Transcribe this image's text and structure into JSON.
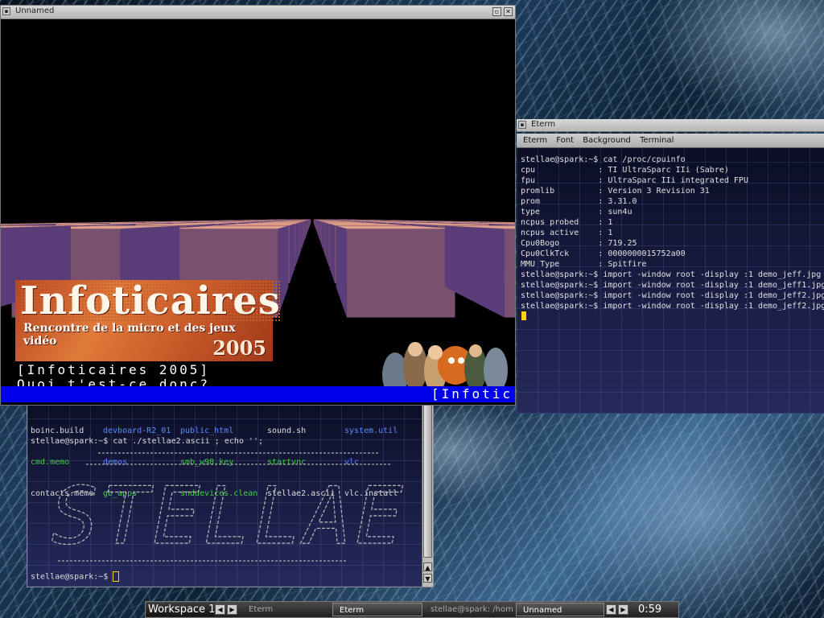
{
  "windows": {
    "demo": {
      "title": "Unnamed"
    },
    "eterm_top": {
      "title": "Eterm",
      "menu": [
        "Eterm",
        "Font",
        "Background",
        "Terminal"
      ],
      "lines": [
        "stellae@spark:~$ cat /proc/cpuinfo",
        "cpu             : TI UltraSparc IIi (Sabre)",
        "fpu             : UltraSparc IIi integrated FPU",
        "promlib         : Version 3 Revision 31",
        "prom            : 3.31.0",
        "type            : sun4u",
        "ncpus probed    : 1",
        "ncpus active    : 1",
        "Cpu0Bogo        : 719.25",
        "Cpu0ClkTck      : 0000000015752a00",
        "MMU Type        : Spitfire",
        "stellae@spark:~$ import -window root -display :1 demo_jeff.jpg",
        "stellae@spark:~$ import -window root -display :1 demo_jeff1.jpg",
        "stellae@spark:~$ import -window root -display :1 demo_jeff2.jpg",
        "stellae@spark:~$ import -window root -display :1 demo_jeff2.jpg"
      ]
    },
    "eterm_bottom": {
      "ls_rows": [
        [
          {
            "text": "boinc.build",
            "color": "#dddddd"
          },
          {
            "text": "devboard-R2_01",
            "color": "#5a8cff"
          },
          {
            "text": "public_html",
            "color": "#5a8cff"
          },
          {
            "text": "sound.sh",
            "color": "#dddddd"
          },
          {
            "text": "system.util",
            "color": "#5a8cff"
          }
        ],
        [
          {
            "text": "cmd.memo",
            "color": "#3cd43c"
          },
          {
            "text": "demos",
            "color": "#5a8cff"
          },
          {
            "text": "smb_w98.key",
            "color": "#3cd43c"
          },
          {
            "text": "startvnc",
            "color": "#3cd43c"
          },
          {
            "text": "vlc",
            "color": "#5a8cff"
          }
        ],
        [
          {
            "text": "contacts.memo",
            "color": "#dddddd"
          },
          {
            "text": "gb_apps",
            "color": "#3cd43c"
          },
          {
            "text": "snddevices.clean",
            "color": "#3cd43c"
          },
          {
            "text": "stellae2.ascii",
            "color": "#dddddd"
          },
          {
            "text": "vlc.install",
            "color": "#dddddd"
          }
        ]
      ],
      "command": "stellae@spark:~$ cat ./stellae2.ascii ; echo '';",
      "ascii_art": "STELLAE",
      "prompt": "stellae@spark:~$ "
    }
  },
  "demo": {
    "logo_title": "Infoticaires",
    "logo_subtitle": "Rencontre de la micro et des jeux vidéo",
    "logo_year": "2005",
    "text_line1": "[Infoticaires 2005]",
    "text_line2": "Quoi t'est-ce donc?",
    "scroller": "[Infotic",
    "colors": {
      "box_top": "#e0a088",
      "box_side": "#5a3c78",
      "box_dark": "#7a5070",
      "bar": "#0000ee"
    }
  },
  "taskbar": {
    "workspace": "Workspace 1",
    "tasks": [
      "Eterm",
      "Eterm",
      "stellae@spark: /hom",
      "Unnamed"
    ],
    "clock": "0:59"
  }
}
